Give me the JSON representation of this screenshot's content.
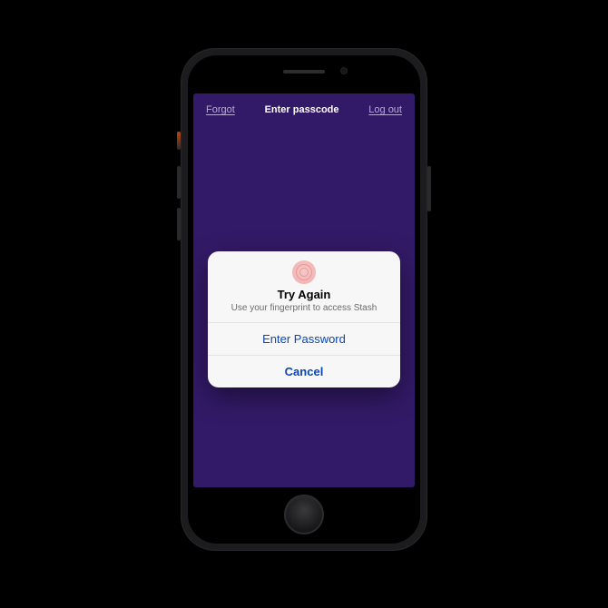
{
  "colors": {
    "screen_bg": "#331a68",
    "alert_bg": "#f7f7f8",
    "alert_action": "#0a46b4"
  },
  "topbar": {
    "forgot_label": "Forgot",
    "title": "Enter passcode",
    "logout_label": "Log out"
  },
  "alert": {
    "icon": "touch-id-icon",
    "title": "Try Again",
    "message": "Use your fingerprint to access Stash",
    "enter_password_label": "Enter Password",
    "cancel_label": "Cancel"
  }
}
